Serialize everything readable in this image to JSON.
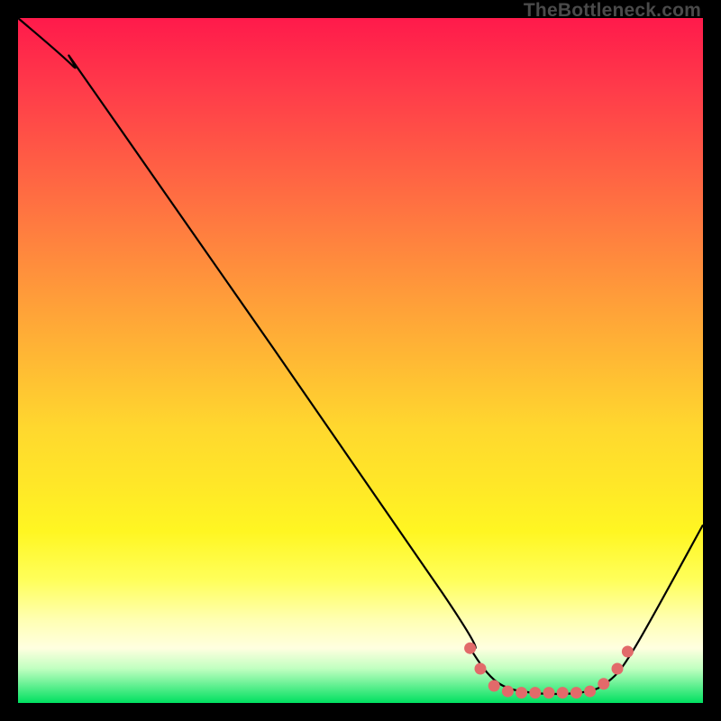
{
  "watermark": "TheBottleneck.com",
  "chart_data": {
    "type": "line",
    "title": "",
    "xlabel": "",
    "ylabel": "",
    "xlim": [
      0,
      100
    ],
    "ylim": [
      0,
      100
    ],
    "grid": false,
    "series": [
      {
        "name": "curve",
        "points": [
          {
            "x": 0,
            "y": 100
          },
          {
            "x": 8,
            "y": 93
          },
          {
            "x": 12,
            "y": 88
          },
          {
            "x": 62,
            "y": 16
          },
          {
            "x": 66,
            "y": 8
          },
          {
            "x": 70,
            "y": 3
          },
          {
            "x": 75,
            "y": 1.5
          },
          {
            "x": 82,
            "y": 1.5
          },
          {
            "x": 86,
            "y": 3
          },
          {
            "x": 90,
            "y": 8
          },
          {
            "x": 100,
            "y": 26
          }
        ]
      }
    ],
    "markers": [
      {
        "x": 66.0,
        "y": 8.0
      },
      {
        "x": 67.5,
        "y": 5.0
      },
      {
        "x": 69.5,
        "y": 2.5
      },
      {
        "x": 71.5,
        "y": 1.7
      },
      {
        "x": 73.5,
        "y": 1.5
      },
      {
        "x": 75.5,
        "y": 1.5
      },
      {
        "x": 77.5,
        "y": 1.5
      },
      {
        "x": 79.5,
        "y": 1.5
      },
      {
        "x": 81.5,
        "y": 1.5
      },
      {
        "x": 83.5,
        "y": 1.7
      },
      {
        "x": 85.5,
        "y": 2.8
      },
      {
        "x": 87.5,
        "y": 5.0
      },
      {
        "x": 89.0,
        "y": 7.5
      }
    ],
    "marker_color": "#e26a6a"
  }
}
